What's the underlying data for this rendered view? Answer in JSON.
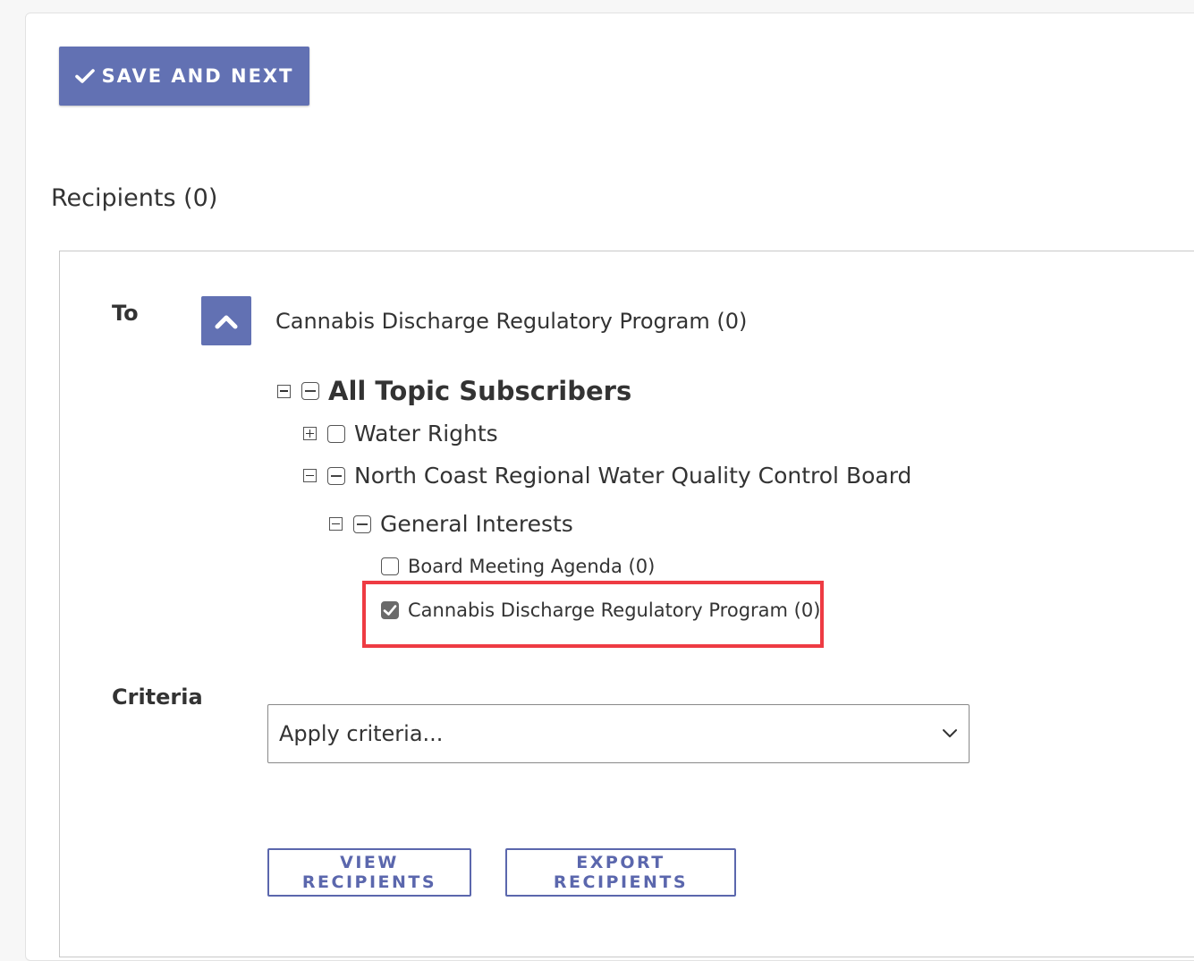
{
  "toolbar": {
    "save_label": "SAVE AND NEXT"
  },
  "recipients": {
    "heading": "Recipients (0)",
    "to_label": "To",
    "selected_summary": "Cannabis Discharge Regulatory Program (0)",
    "tree": {
      "root": "All Topic Subscribers",
      "water_rights": "Water Rights",
      "north_coast": "North Coast Regional Water Quality Control Board",
      "general_interests": "General Interests",
      "board_meeting": "Board Meeting Agenda (0)",
      "cannabis": "Cannabis Discharge Regulatory Program (0)"
    },
    "criteria_label": "Criteria",
    "criteria_value": "Apply criteria...",
    "view_label": "VIEW RECIPIENTS",
    "export_label": "EXPORT RECIPIENTS"
  },
  "colors": {
    "primary": "#6271b3",
    "outline": "#5b67ad",
    "highlight": "#ee3b43"
  },
  "icons": {
    "save": "check-icon",
    "collapse": "chevron-up-icon",
    "select": "chevron-down-icon"
  }
}
